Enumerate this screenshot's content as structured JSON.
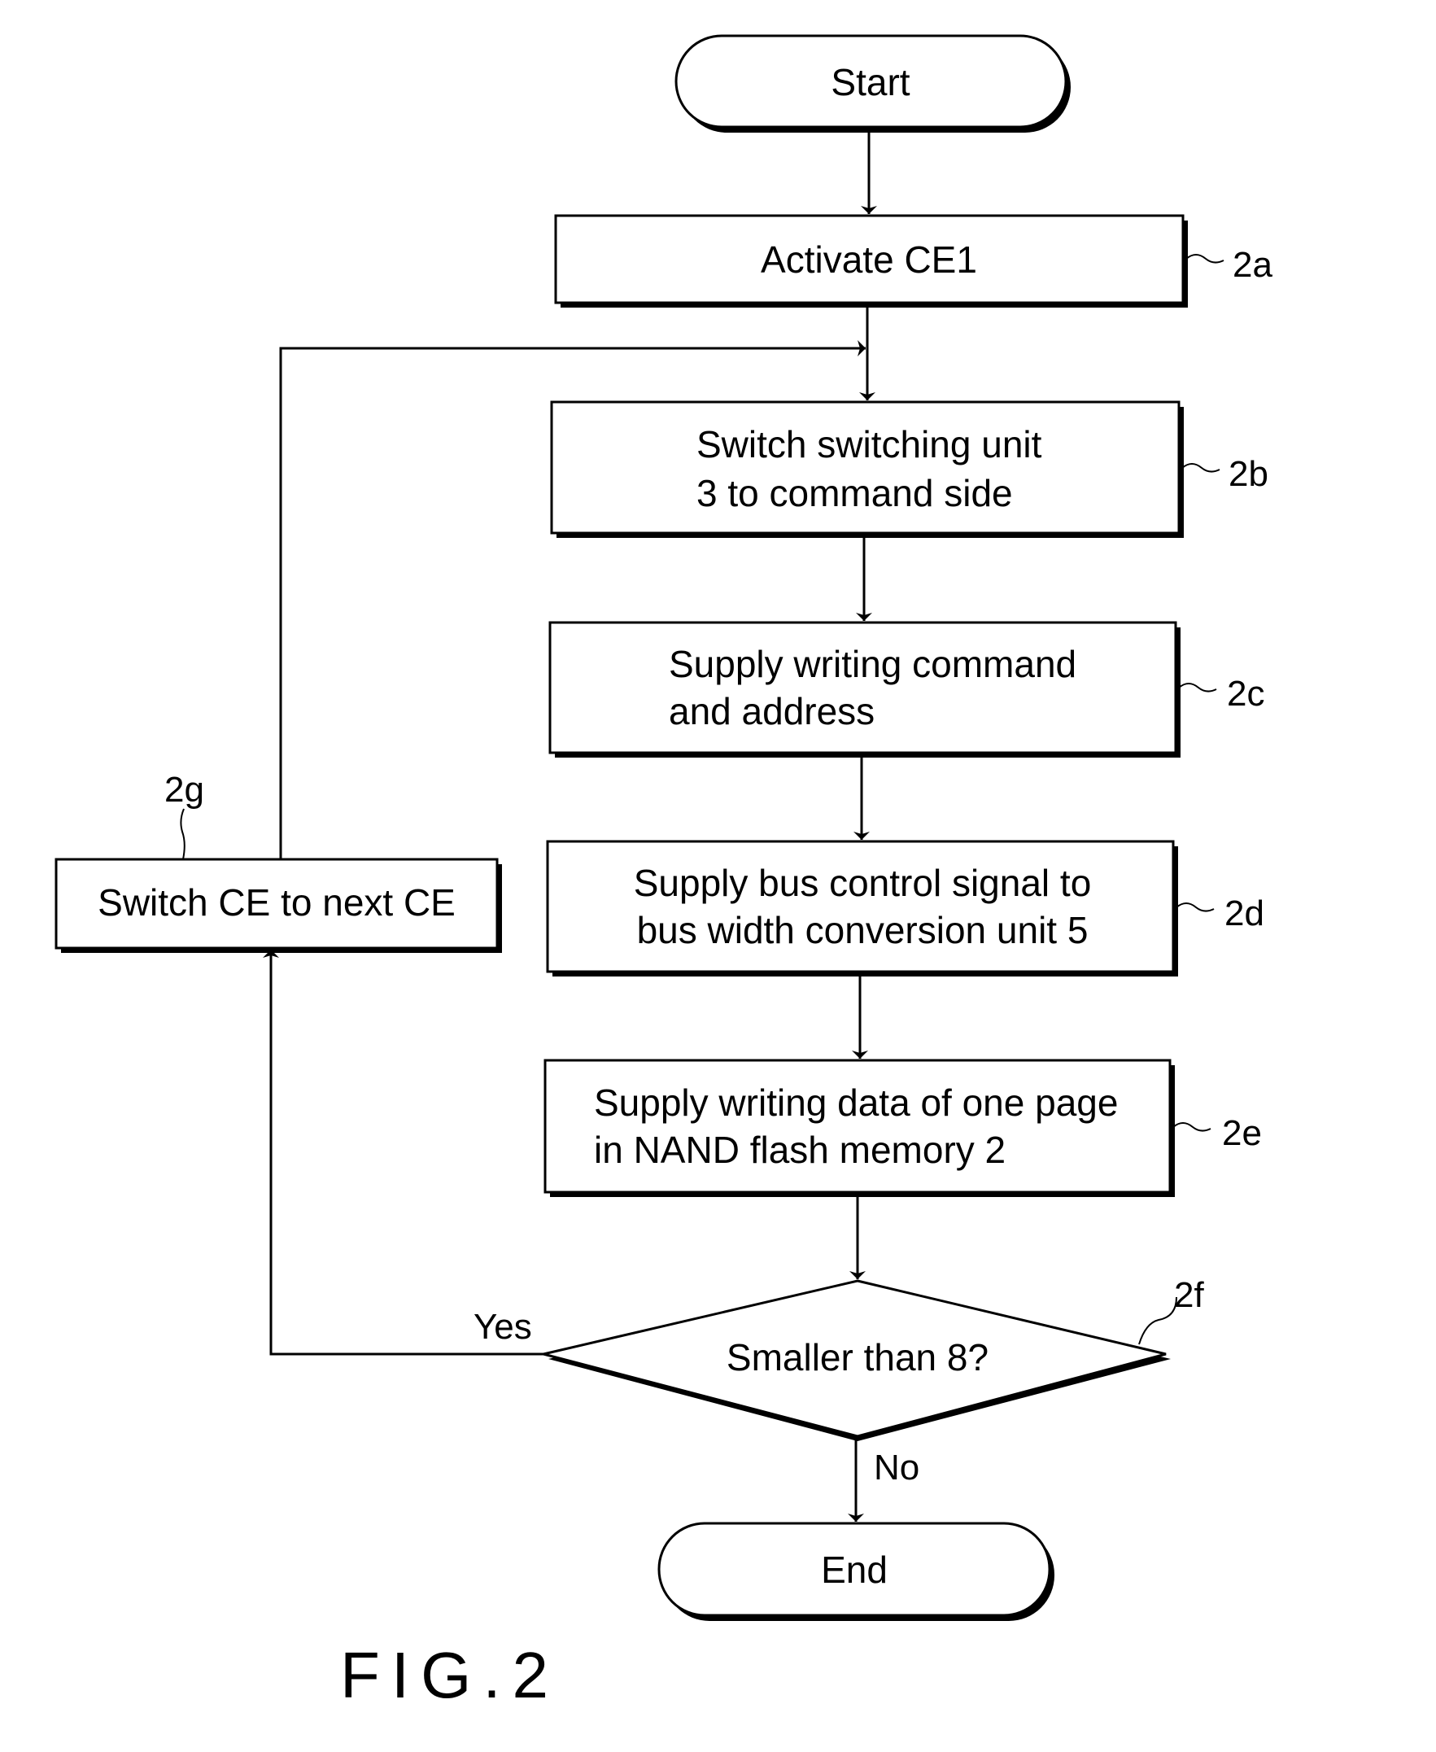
{
  "figure": {
    "caption": "FIG.2",
    "start_label": "Start",
    "end_label": "End",
    "steps": [
      {
        "id": "2a",
        "lines": [
          "Activate CE1"
        ]
      },
      {
        "id": "2b",
        "lines": [
          "Switch switching unit",
          "3 to command side"
        ]
      },
      {
        "id": "2c",
        "lines": [
          "Supply writing command",
          "and address"
        ]
      },
      {
        "id": "2d",
        "lines": [
          "Supply bus control signal to",
          "bus width conversion unit 5"
        ]
      },
      {
        "id": "2e",
        "lines": [
          "Supply writing data of one page",
          "in NAND flash memory 2"
        ]
      }
    ],
    "decision": {
      "id": "2f",
      "label": "Smaller than 8?",
      "yes_label": "Yes",
      "no_label": "No"
    },
    "loop_step": {
      "id": "2g",
      "label": "Switch CE to next CE"
    }
  }
}
